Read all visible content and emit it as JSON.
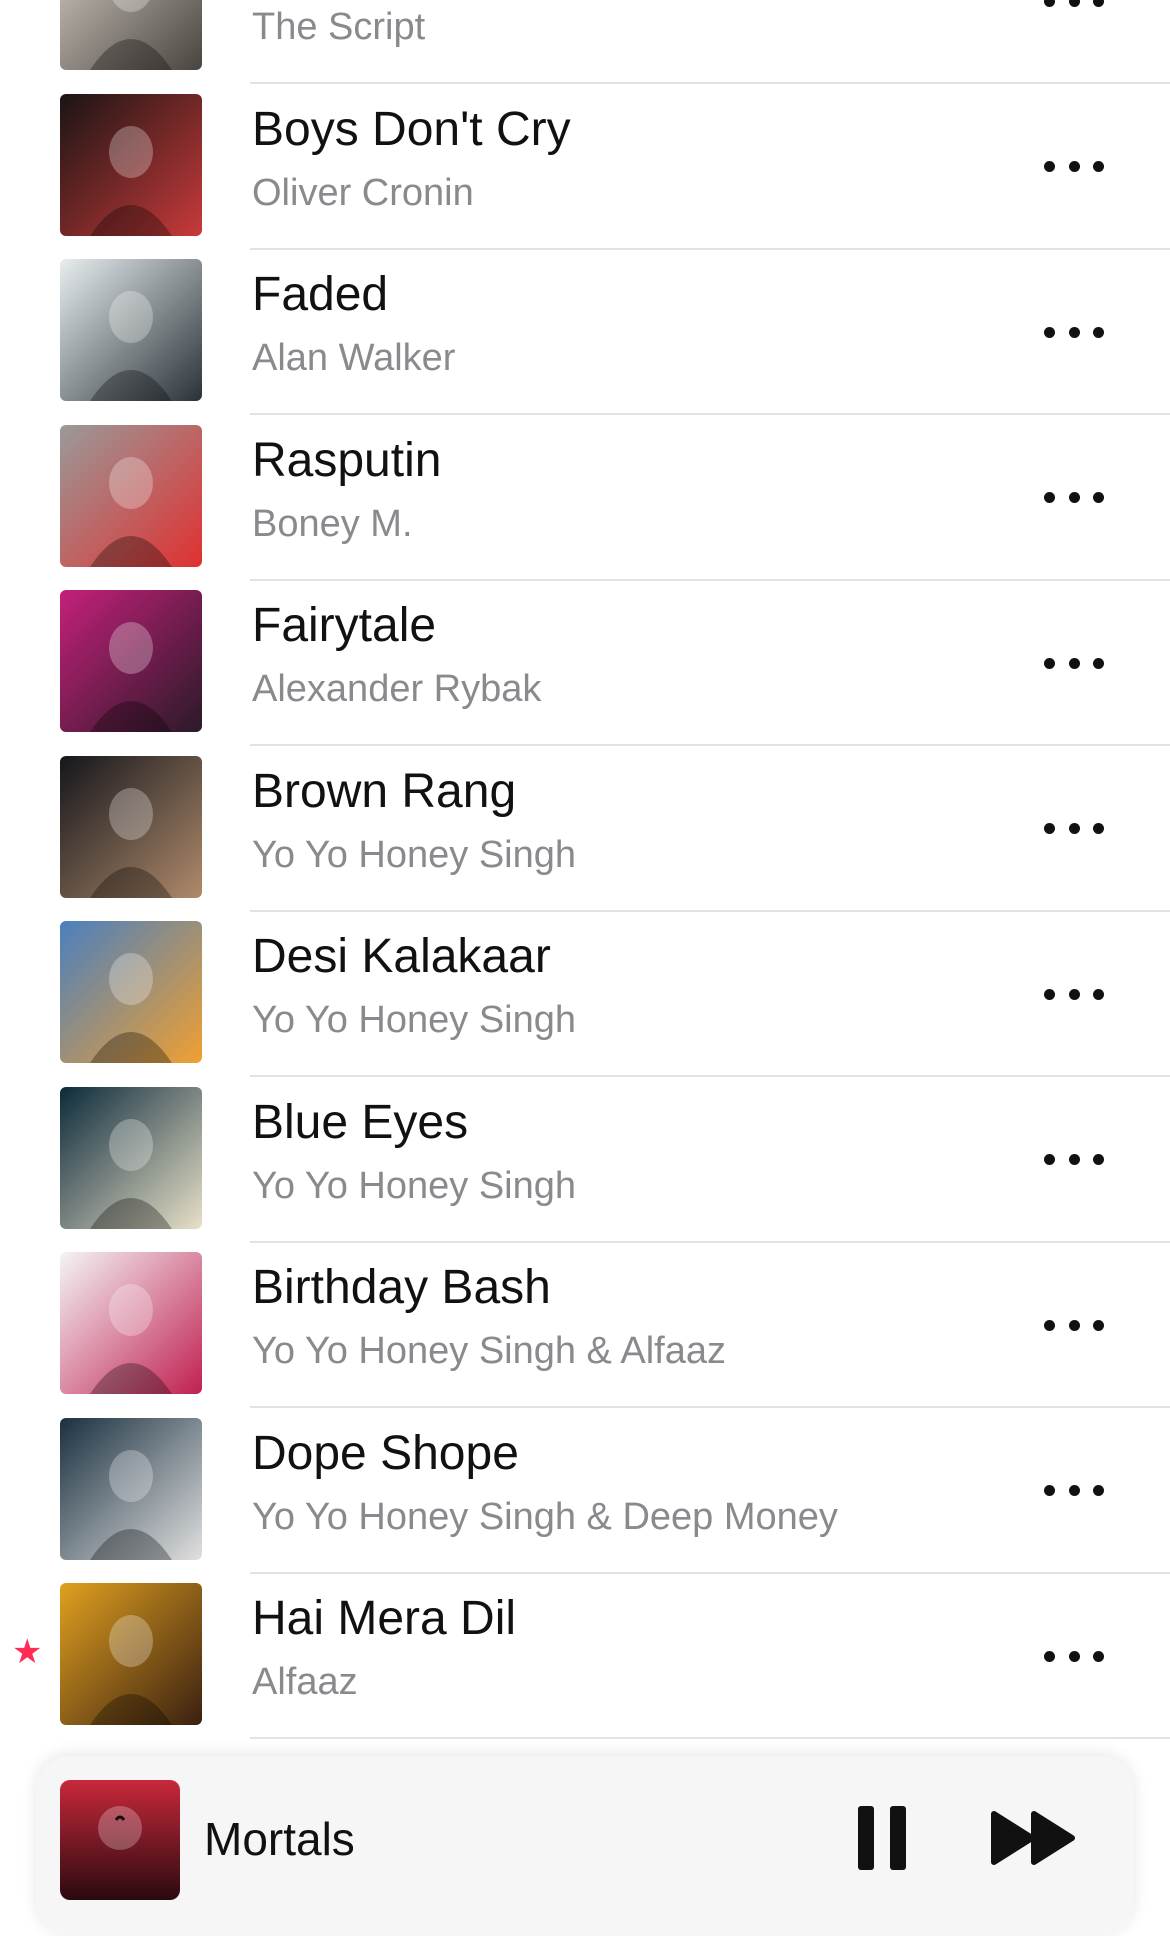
{
  "songs": [
    {
      "title": "",
      "artist": "The Script",
      "starred": true,
      "art_colors": [
        "#d8d2c8",
        "#4a4440"
      ]
    },
    {
      "title": "Boys Don't Cry",
      "artist": "Oliver Cronin",
      "starred": false,
      "art_colors": [
        "#1a1414",
        "#c83a3a"
      ]
    },
    {
      "title": "Faded",
      "artist": "Alan Walker",
      "starred": false,
      "art_colors": [
        "#e8eef0",
        "#2a3238"
      ]
    },
    {
      "title": "Rasputin",
      "artist": "Boney M.",
      "starred": false,
      "art_colors": [
        "#9a9a9a",
        "#e03030"
      ]
    },
    {
      "title": "Fairytale",
      "artist": "Alexander Rybak",
      "starred": false,
      "art_colors": [
        "#c4207a",
        "#2a1a28"
      ]
    },
    {
      "title": "Brown Rang",
      "artist": "Yo Yo Honey Singh",
      "starred": false,
      "art_colors": [
        "#14161c",
        "#b08a6a"
      ]
    },
    {
      "title": "Desi Kalakaar",
      "artist": "Yo Yo Honey Singh",
      "starred": false,
      "art_colors": [
        "#4a7fc0",
        "#f0a030"
      ]
    },
    {
      "title": "Blue Eyes",
      "artist": "Yo Yo Honey Singh",
      "starred": false,
      "art_colors": [
        "#0c2a3a",
        "#e8e0c8"
      ]
    },
    {
      "title": "Birthday Bash",
      "artist": "Yo Yo Honey Singh & Alfaaz",
      "starred": false,
      "art_colors": [
        "#f4f4f6",
        "#c02050"
      ]
    },
    {
      "title": "Dope Shope",
      "artist": "Yo Yo Honey Singh & Deep Money",
      "starred": false,
      "art_colors": [
        "#1a3040",
        "#e0e0e0"
      ]
    },
    {
      "title": "Hai Mera Dil",
      "artist": "Alfaaz",
      "starred": true,
      "art_colors": [
        "#e0a020",
        "#3a2010"
      ]
    }
  ],
  "mini_player": {
    "title": "Mortals",
    "art_colors": [
      "#c8283a",
      "#2a0a10"
    ]
  },
  "icons": {
    "star": "★",
    "more": "more-icon",
    "pause": "pause-icon",
    "next": "forward-icon"
  },
  "colors": {
    "accent_star": "#ff2d55",
    "secondary_text": "#8a8a8e"
  }
}
